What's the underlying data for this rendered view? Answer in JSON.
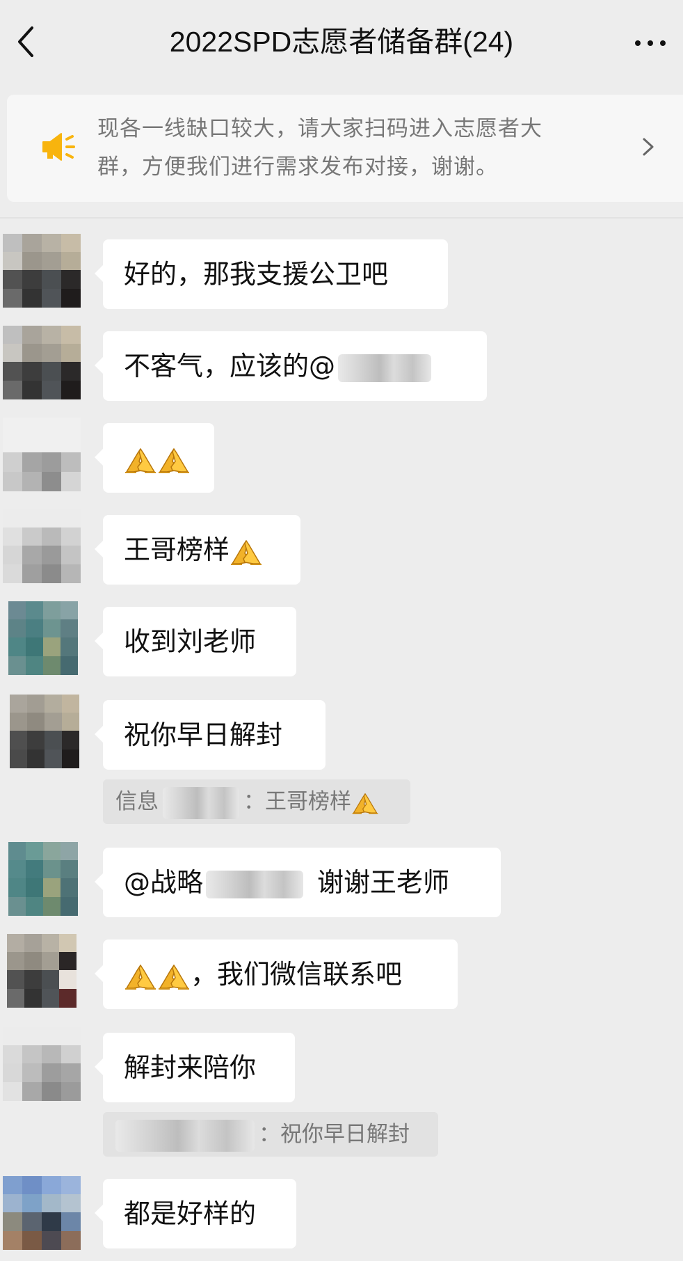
{
  "header": {
    "title": "2022SPD志愿者储备群(24)",
    "back_icon": "chevron-left-icon",
    "more_icon": "more-dots-icon"
  },
  "notice": {
    "icon": "megaphone-icon",
    "text_line1": "现各一线缺口较大，请大家扫码进入志愿者大",
    "text_line2": "群，方便我们进行需求发布对接，谢谢。",
    "accent_color": "#f8b40e"
  },
  "messages": [
    {
      "text": "好的，那我支援公卫吧"
    },
    {
      "text": "不客气，应该的@"
    },
    {
      "emoji": "folded-hands-icon"
    },
    {
      "text": "王哥榜样"
    },
    {
      "text": "收到刘老师"
    },
    {
      "text": "祝你早日解封",
      "quote_prefix": "信息",
      "quote_text": "：王哥榜样"
    },
    {
      "text_prefix": "@战略",
      "text": "谢谢王老师"
    },
    {
      "text": "，我们微信联系吧"
    },
    {
      "text": "解封来陪你",
      "quote_text": "：祝你早日解封"
    },
    {
      "text": "都是好样的"
    }
  ]
}
